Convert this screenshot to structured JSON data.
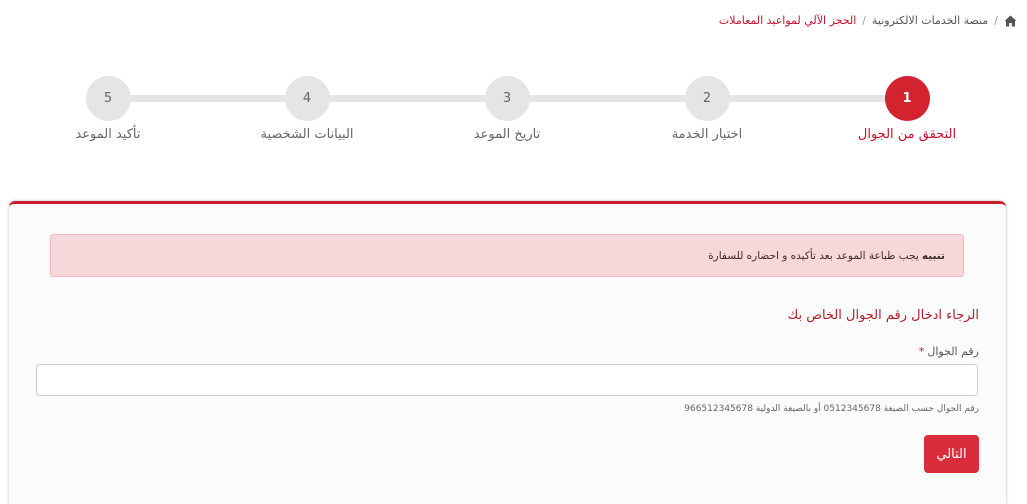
{
  "breadcrumb": {
    "items": [
      {
        "label": "منصة الخدمات الالكترونية"
      },
      {
        "label": "الحجز الآلي لمواعيد المعاملات"
      }
    ],
    "separator": "/"
  },
  "stepper": {
    "steps": [
      {
        "number": "1",
        "label": "التحقق من الجوال",
        "active": true
      },
      {
        "number": "2",
        "label": "اختيار الخدمة"
      },
      {
        "number": "3",
        "label": "تاريخ الموعد"
      },
      {
        "number": "4",
        "label": "البيانات الشخصية"
      },
      {
        "number": "5",
        "label": "تأكيد الموعد"
      }
    ]
  },
  "alert": {
    "title": "تنبيه",
    "message": "يجب طباعة الموعد بعد تأكيده و احضاره للسفارة"
  },
  "form": {
    "heading": "الرجاء ادخال رقم الجوال الخاص بك",
    "phone_label": "رقم الجوال",
    "required_mark": "*",
    "phone_value": "",
    "hint": "رقم الجوال حسب الصيغة 0512345678 أو بالصيغة الدولية 966512345678",
    "next_label": "التالي"
  },
  "colors": {
    "accent": "#d2232f",
    "alert_bg": "#f8d7da",
    "step_inactive": "#e3e5e6"
  }
}
